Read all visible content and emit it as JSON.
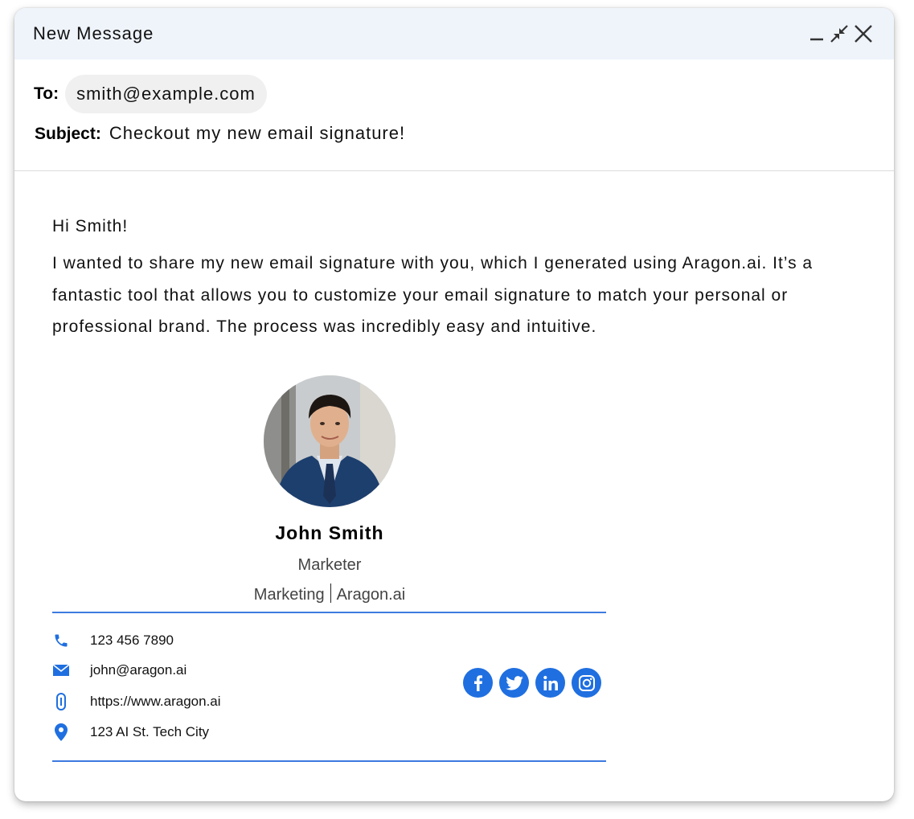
{
  "window": {
    "title": "New Message"
  },
  "header": {
    "to_label": "To:",
    "to_value": "smith@example.com",
    "subject_label": "Subject:",
    "subject_value": "Checkout my new email signature!"
  },
  "body": {
    "greeting": "Hi Smith!",
    "paragraph": "I wanted to share my new email signature with you, which I generated using Aragon.ai. It’s a fantastic tool that allows you to customize your email signature to match your personal or professional brand. The process was incredibly easy and intuitive."
  },
  "signature": {
    "name": "John Smith",
    "role": "Marketer",
    "department": "Marketing",
    "company": "Aragon.ai",
    "phone": "123 456 7890",
    "email": "john@aragon.ai",
    "website": "https://www.aragon.ai",
    "address": "123 AI St. Tech City",
    "socials": [
      "facebook-icon",
      "twitter-icon",
      "linkedin-icon",
      "instagram-icon"
    ]
  },
  "colors": {
    "titlebar_bg": "#eff4fb",
    "accent_blue": "#1f6fe0",
    "divider_blue": "#3d7ae0"
  }
}
